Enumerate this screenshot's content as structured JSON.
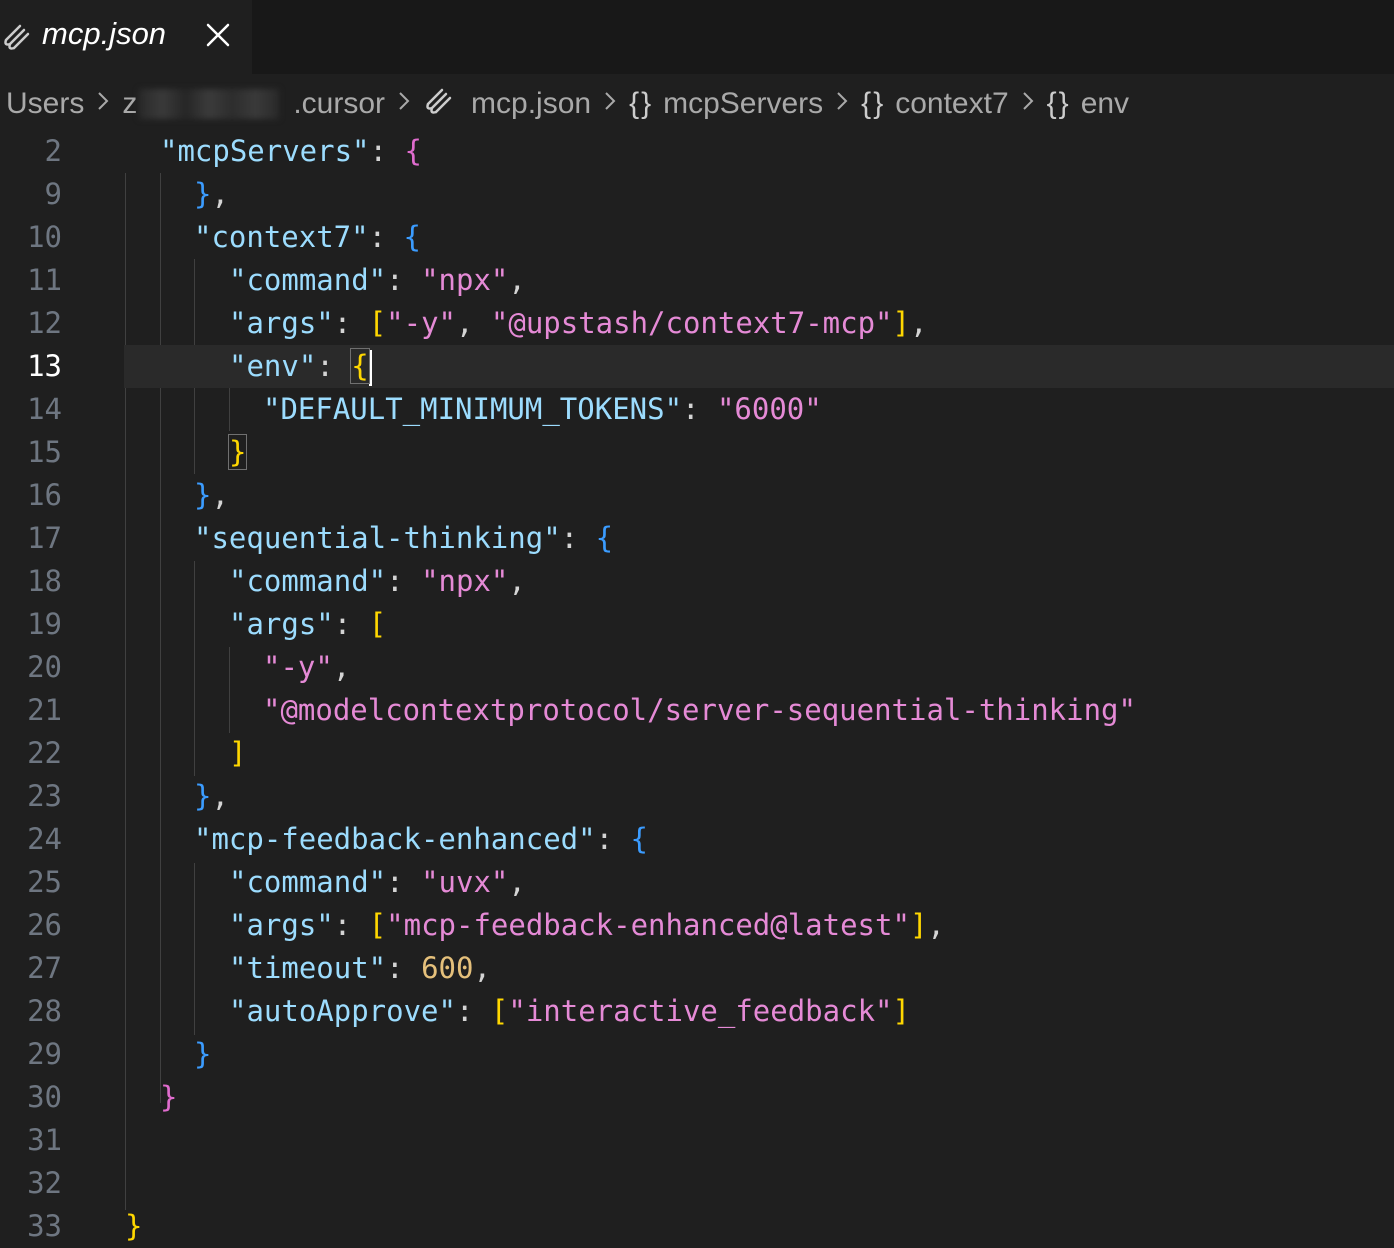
{
  "tab": {
    "label": "mcp.json",
    "icon": "file-json-icon",
    "close_icon": "close-icon"
  },
  "breadcrumb": {
    "users": "Users",
    "blurred_prefix": "z",
    "cursor_dir": ".cursor",
    "file": "mcp.json",
    "mcpServers": "mcpServers",
    "context7": "context7",
    "env": "env",
    "object_symbol": "{}"
  },
  "editor": {
    "current_line": 13,
    "lines": [
      {
        "n": "2"
      },
      {
        "n": "9"
      },
      {
        "n": "10"
      },
      {
        "n": "11"
      },
      {
        "n": "12"
      },
      {
        "n": "13"
      },
      {
        "n": "14"
      },
      {
        "n": "15"
      },
      {
        "n": "16"
      },
      {
        "n": "17"
      },
      {
        "n": "18"
      },
      {
        "n": "19"
      },
      {
        "n": "20"
      },
      {
        "n": "21"
      },
      {
        "n": "22"
      },
      {
        "n": "23"
      },
      {
        "n": "24"
      },
      {
        "n": "25"
      },
      {
        "n": "26"
      },
      {
        "n": "27"
      },
      {
        "n": "28"
      },
      {
        "n": "29"
      },
      {
        "n": "30"
      },
      {
        "n": "31"
      },
      {
        "n": "32"
      },
      {
        "n": "33"
      }
    ],
    "tokens": {
      "mcpServers_key": "\"mcpServers\"",
      "context7_key": "\"context7\"",
      "command_key": "\"command\"",
      "npx": "\"npx\"",
      "args_key": "\"args\"",
      "dash_y": "\"-y\"",
      "upstash": "\"@upstash/context7-mcp\"",
      "env_key": "\"env\"",
      "default_min_key": "\"DEFAULT_MINIMUM_TOKENS\"",
      "six_thousand": "\"6000\"",
      "seq_key": "\"sequential-thinking\"",
      "modelcontext": "\"@modelcontextprotocol/server-sequential-thinking\"",
      "feedback_key": "\"mcp-feedback-enhanced\"",
      "uvx": "\"uvx\"",
      "feedback_latest": "\"mcp-feedback-enhanced@latest\"",
      "timeout_key": "\"timeout\"",
      "timeout_val": "600",
      "autoapprove_key": "\"autoApprove\"",
      "interactive": "\"interactive_feedback\""
    }
  },
  "colors": {
    "background": "#1f1f1f",
    "key": "#9cdcfe",
    "string": "#e58ad6",
    "number": "#e5c07b",
    "brace_level1": "#e06cce",
    "brace_level2": "#3b9cff",
    "brace_level3": "#ffd700"
  }
}
